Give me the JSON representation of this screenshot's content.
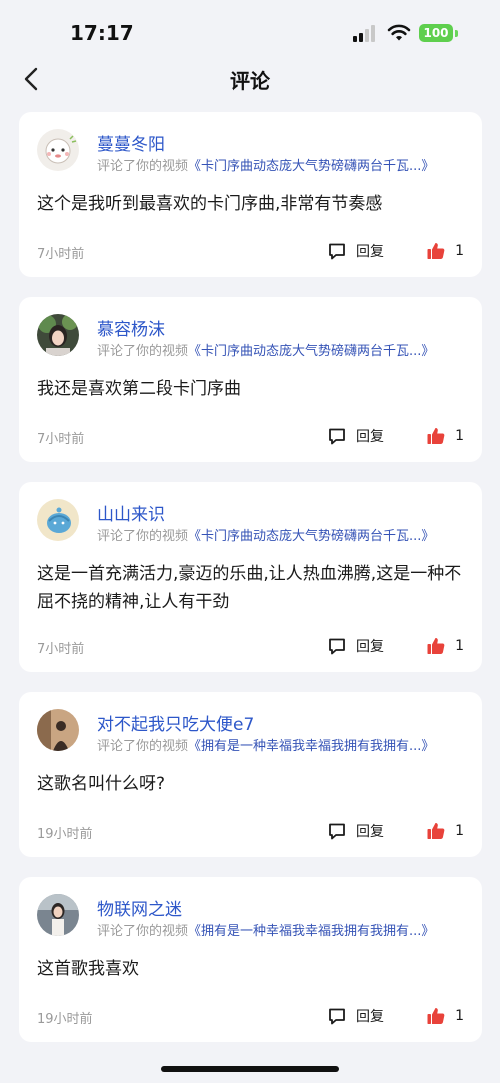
{
  "status_bar": {
    "time": "17:17",
    "battery": "100"
  },
  "nav": {
    "title": "评论"
  },
  "subline_prefix": "评论了你的视频",
  "colors": {
    "username": "#2d57c9",
    "video_link": "#3553b6",
    "like": "#e8423a",
    "battery": "#5fcf4e"
  },
  "comments": [
    {
      "user": "蔓蔓冬阳",
      "video": "《卡门序曲动态庞大气势磅礴两台千瓦...》",
      "text": "这个是我听到最喜欢的卡门序曲,非常有节奏感",
      "time": "7小时前",
      "reply": "回复",
      "likes": "1"
    },
    {
      "user": "慕容杨沫",
      "video": "《卡门序曲动态庞大气势磅礴两台千瓦...》",
      "text": "我还是喜欢第二段卡门序曲",
      "time": "7小时前",
      "reply": "回复",
      "likes": "1"
    },
    {
      "user": "山山来识",
      "video": "《卡门序曲动态庞大气势磅礴两台千瓦...》",
      "text": "这是一首充满活力,豪迈的乐曲,让人热血沸腾,这是一种不屈不挠的精神,让人有干劲",
      "time": "7小时前",
      "reply": "回复",
      "likes": "1"
    },
    {
      "user": "对不起我只吃大便e7",
      "video": "《拥有是一种幸福我幸福我拥有我拥有...》",
      "text": "这歌名叫什么呀?",
      "time": "19小时前",
      "reply": "回复",
      "likes": "1"
    },
    {
      "user": "物联网之迷",
      "video": "《拥有是一种幸福我幸福我拥有我拥有...》",
      "text": "这首歌我喜欢",
      "time": "19小时前",
      "reply": "回复",
      "likes": "1"
    }
  ]
}
